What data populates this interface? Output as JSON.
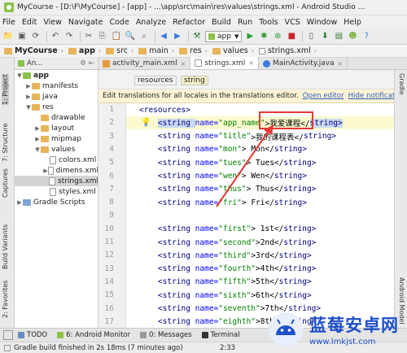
{
  "window": {
    "title": "MyCourse - [D:\\F\\MyCourse] - [app] - ...\\app\\src\\main\\res\\values\\strings.xml - Android Studio ..."
  },
  "menu": [
    "File",
    "Edit",
    "View",
    "Navigate",
    "Code",
    "Analyze",
    "Refactor",
    "Build",
    "Run",
    "Tools",
    "VCS",
    "Window",
    "Help"
  ],
  "toolbar": {
    "run_config": "app"
  },
  "breadcrumbs": [
    "MyCourse",
    "app",
    "src",
    "main",
    "res",
    "values",
    "strings.xml"
  ],
  "project_panel": {
    "view_label": "An..."
  },
  "editor_tabs": [
    {
      "label": "activity_main.xml",
      "active": false
    },
    {
      "label": "strings.xml",
      "active": true
    },
    {
      "label": "MainActivity.java",
      "active": false
    }
  ],
  "editor_subtabs": [
    "resources",
    "string"
  ],
  "notice": {
    "text": "Edit translations for all locales in the translations editor.",
    "open_editor": "Open editor",
    "hide": "Hide notification"
  },
  "tree": [
    {
      "label": "app",
      "depth": 0,
      "arrow": "▼",
      "kind": "module"
    },
    {
      "label": "manifests",
      "depth": 1,
      "arrow": "▶",
      "kind": "folder"
    },
    {
      "label": "java",
      "depth": 1,
      "arrow": "▶",
      "kind": "folder"
    },
    {
      "label": "res",
      "depth": 1,
      "arrow": "▼",
      "kind": "folder"
    },
    {
      "label": "drawable",
      "depth": 2,
      "arrow": "",
      "kind": "folder"
    },
    {
      "label": "layout",
      "depth": 2,
      "arrow": "▶",
      "kind": "folder"
    },
    {
      "label": "mipmap",
      "depth": 2,
      "arrow": "▶",
      "kind": "folder"
    },
    {
      "label": "values",
      "depth": 2,
      "arrow": "▼",
      "kind": "folder"
    },
    {
      "label": "colors.xml",
      "depth": 3,
      "arrow": "",
      "kind": "file"
    },
    {
      "label": "dimens.xml",
      "depth": 3,
      "arrow": "▶",
      "kind": "file"
    },
    {
      "label": "strings.xml",
      "depth": 3,
      "arrow": "",
      "kind": "file",
      "selected": true
    },
    {
      "label": "styles.xml",
      "depth": 3,
      "arrow": "",
      "kind": "file"
    },
    {
      "label": "Gradle Scripts",
      "depth": 0,
      "arrow": "▶",
      "kind": "gradle"
    }
  ],
  "left_tool_windows": [
    "1: Project",
    "7: Structure",
    "Captures",
    "Build Variants",
    "2: Favorites"
  ],
  "right_tool_windows": [
    "Gradle",
    "Android Model"
  ],
  "code": {
    "line_numbers": [
      "1",
      "2",
      "3",
      "4",
      "5",
      "6",
      "7",
      "8",
      "9",
      "10",
      "11",
      "12",
      "13",
      "14",
      "15",
      "16",
      "17",
      "18"
    ],
    "lines": [
      [
        {
          "t": "<resources>",
          "c": "tg"
        }
      ],
      [
        {
          "t": "    "
        },
        {
          "t": "<string ",
          "c": "tg"
        },
        {
          "t": "name=",
          "c": "an"
        },
        {
          "t": "\"app_name\"",
          "c": "av"
        },
        {
          "t": ">我爱课程</",
          "c": "tx"
        },
        {
          "t": "string>",
          "c": "tg"
        }
      ],
      [
        {
          "t": "    "
        },
        {
          "t": "<string ",
          "c": "tg"
        },
        {
          "t": "name=",
          "c": "an"
        },
        {
          "t": "\"title\"",
          "c": "av"
        },
        {
          "t": ">我的课程表</",
          "c": "tx"
        },
        {
          "t": "string>",
          "c": "tg"
        }
      ],
      [
        {
          "t": "    "
        },
        {
          "t": "<string ",
          "c": "tg"
        },
        {
          "t": "name=",
          "c": "an"
        },
        {
          "t": "\"mon\"",
          "c": "av"
        },
        {
          "t": "> Mon</",
          "c": "tx"
        },
        {
          "t": "string>",
          "c": "tg"
        }
      ],
      [
        {
          "t": "    "
        },
        {
          "t": "<string ",
          "c": "tg"
        },
        {
          "t": "name=",
          "c": "an"
        },
        {
          "t": "\"tues\"",
          "c": "av"
        },
        {
          "t": "> Tues</",
          "c": "tx"
        },
        {
          "t": "string>",
          "c": "tg"
        }
      ],
      [
        {
          "t": "    "
        },
        {
          "t": "<string ",
          "c": "tg"
        },
        {
          "t": "name=",
          "c": "an"
        },
        {
          "t": "\"wen\"",
          "c": "av"
        },
        {
          "t": "> Wen</",
          "c": "tx"
        },
        {
          "t": "string>",
          "c": "tg"
        }
      ],
      [
        {
          "t": "    "
        },
        {
          "t": "<string ",
          "c": "tg"
        },
        {
          "t": "name=",
          "c": "an"
        },
        {
          "t": "\"thus\"",
          "c": "av"
        },
        {
          "t": "> Thus</",
          "c": "tx"
        },
        {
          "t": "string>",
          "c": "tg"
        }
      ],
      [
        {
          "t": "    "
        },
        {
          "t": "<string ",
          "c": "tg"
        },
        {
          "t": "name=",
          "c": "an"
        },
        {
          "t": "\"fri\"",
          "c": "av"
        },
        {
          "t": "> Fri</",
          "c": "tx"
        },
        {
          "t": "string>",
          "c": "tg"
        }
      ],
      [
        {
          "t": ""
        }
      ],
      [
        {
          "t": "    "
        },
        {
          "t": "<string ",
          "c": "tg"
        },
        {
          "t": "name=",
          "c": "an"
        },
        {
          "t": "\"first\"",
          "c": "av"
        },
        {
          "t": "> 1st</",
          "c": "tx"
        },
        {
          "t": "string>",
          "c": "tg"
        }
      ],
      [
        {
          "t": "    "
        },
        {
          "t": "<string ",
          "c": "tg"
        },
        {
          "t": "name=",
          "c": "an"
        },
        {
          "t": "\"second\"",
          "c": "av"
        },
        {
          "t": ">2nd</",
          "c": "tx"
        },
        {
          "t": "string>",
          "c": "tg"
        }
      ],
      [
        {
          "t": "    "
        },
        {
          "t": "<string ",
          "c": "tg"
        },
        {
          "t": "name=",
          "c": "an"
        },
        {
          "t": "\"third\"",
          "c": "av"
        },
        {
          "t": ">3rd</",
          "c": "tx"
        },
        {
          "t": "string>",
          "c": "tg"
        }
      ],
      [
        {
          "t": "    "
        },
        {
          "t": "<string ",
          "c": "tg"
        },
        {
          "t": "name=",
          "c": "an"
        },
        {
          "t": "\"fourth\"",
          "c": "av"
        },
        {
          "t": ">4th</",
          "c": "tx"
        },
        {
          "t": "string>",
          "c": "tg"
        }
      ],
      [
        {
          "t": "    "
        },
        {
          "t": "<string ",
          "c": "tg"
        },
        {
          "t": "name=",
          "c": "an"
        },
        {
          "t": "\"fifth\"",
          "c": "av"
        },
        {
          "t": ">5th</",
          "c": "tx"
        },
        {
          "t": "string>",
          "c": "tg"
        }
      ],
      [
        {
          "t": "    "
        },
        {
          "t": "<string ",
          "c": "tg"
        },
        {
          "t": "name=",
          "c": "an"
        },
        {
          "t": "\"sixth\"",
          "c": "av"
        },
        {
          "t": ">6th</",
          "c": "tx"
        },
        {
          "t": "string>",
          "c": "tg"
        }
      ],
      [
        {
          "t": "    "
        },
        {
          "t": "<string ",
          "c": "tg"
        },
        {
          "t": "name=",
          "c": "an"
        },
        {
          "t": "\"seventh\"",
          "c": "av"
        },
        {
          "t": ">7th</",
          "c": "tx"
        },
        {
          "t": "string>",
          "c": "tg"
        }
      ],
      [
        {
          "t": "    "
        },
        {
          "t": "<string ",
          "c": "tg"
        },
        {
          "t": "name=",
          "c": "an"
        },
        {
          "t": "\"eighth\"",
          "c": "av"
        },
        {
          "t": ">8th</",
          "c": "tx"
        },
        {
          "t": "string>",
          "c": "tg"
        }
      ],
      [
        {
          "t": ""
        }
      ]
    ]
  },
  "bottom_tools": [
    "TODO",
    "6: Android Monitor",
    "0: Messages",
    "Terminal"
  ],
  "status": {
    "message": "Gradle build finished in 2s 18ms (7 minutes ago)",
    "position": "2:33"
  },
  "watermark": {
    "brand": "蓝莓安卓网",
    "url": "www.lmkjst.com"
  },
  "colors": {
    "highlight_box": "#e53935",
    "current_line": "#fbfacf",
    "brand_blue": "#1e50c8"
  }
}
